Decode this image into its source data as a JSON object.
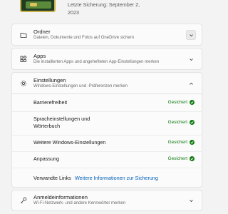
{
  "backup": {
    "last_backup": "Letzte Sicherung: September 2, 2023"
  },
  "sections": {
    "ordner": {
      "title": "Ordner",
      "description": "Dateien, Dokumente und Fotos auf OneDrive sichern"
    },
    "apps": {
      "title": "Apps",
      "description": "Die installierten Apps und angehefteten App-Einstellungen merken"
    },
    "einstellungen": {
      "title": "Einstellungen",
      "description": "Windows-Einstellungen und -Präferenzen merken",
      "items": [
        {
          "label": "Barrierefreiheit",
          "status": "Gesichert"
        },
        {
          "label": "Spracheinstellungen und Wörterbuch",
          "status": "Gesichert"
        },
        {
          "label": "Weitere Windows-Einstellungen",
          "status": "Gesichert"
        },
        {
          "label": "Anpassung",
          "status": "Gesichert"
        }
      ],
      "related_label": "Verwandte Links",
      "related_link": "Weitere Informationen zur Sicherung"
    },
    "anmelde": {
      "title": "Anmeldeinformationen",
      "description": "Wi-Fi-Netzwerk- und andere Kennwörter merken"
    }
  },
  "colors": {
    "success": "#0f7b0f",
    "link": "#005fb8"
  }
}
